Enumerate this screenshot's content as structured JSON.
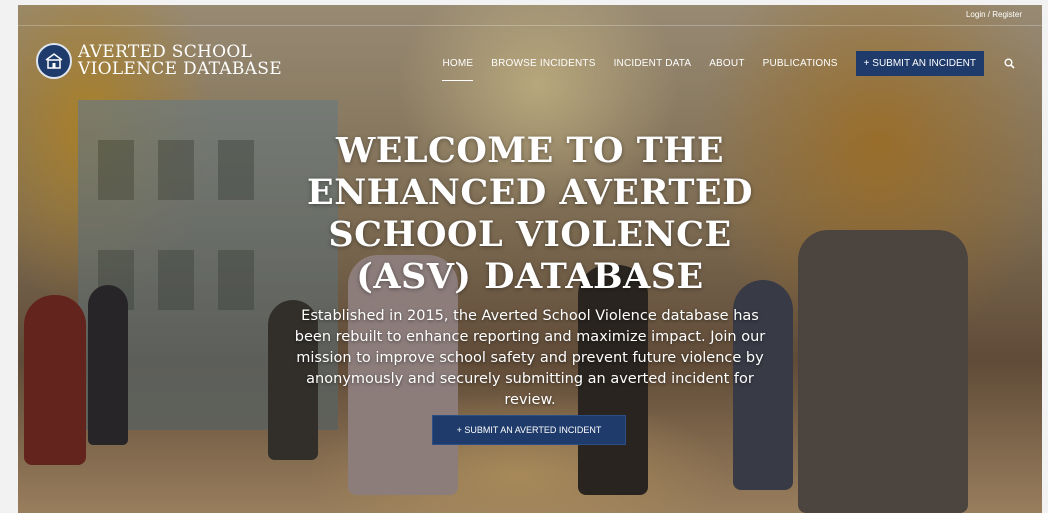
{
  "topbar": {
    "login_label": "Login / Register"
  },
  "logo": {
    "line1": "AVERTED SCHOOL",
    "line2": "VIOLENCE DATABASE"
  },
  "nav": {
    "items": [
      {
        "label": "HOME",
        "active": true
      },
      {
        "label": "BROWSE INCIDENTS"
      },
      {
        "label": "INCIDENT DATA"
      },
      {
        "label": "ABOUT"
      },
      {
        "label": "PUBLICATIONS"
      }
    ],
    "cta_label": "+ SUBMIT AN INCIDENT",
    "search_icon": "search-icon"
  },
  "hero": {
    "title": "WELCOME TO THE ENHANCED AVERTED SCHOOL VIOLENCE (ASV) DATABASE",
    "description": "Established in 2015, the Averted School Violence database has been rebuilt to enhance reporting and maximize impact. Join our mission to improve school safety and prevent future violence by anonymously and securely submitting an averted incident for review.",
    "button_label": "+ SUBMIT AN AVERTED INCIDENT"
  },
  "colors": {
    "brand_navy": "#1f3b6b",
    "text": "#ffffff"
  }
}
